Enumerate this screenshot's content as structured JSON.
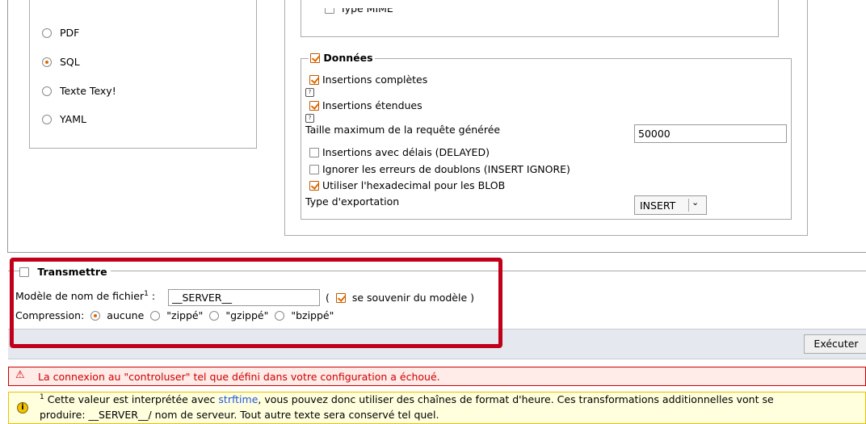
{
  "formats": [
    {
      "label": "PDF",
      "selected": false
    },
    {
      "label": "SQL",
      "selected": true
    },
    {
      "label": "Texte Texy!",
      "selected": false
    },
    {
      "label": "YAML",
      "selected": false
    }
  ],
  "structure": {
    "mime_label": "Type MIME"
  },
  "data_section": {
    "legend": "Données",
    "complete_inserts": "Insertions complètes",
    "extended_inserts": "Insertions étendues",
    "max_query_label": "Taille maximum de la requête générée",
    "max_query_value": "50000",
    "delayed_inserts": "Insertions avec délais (DELAYED)",
    "ignore_errors": "Ignorer les erreurs de doublons (INSERT IGNORE)",
    "hex_blob": "Utiliser l'hexadecimal pour les BLOB",
    "export_type_label": "Type d'exportation",
    "export_type_value": "INSERT"
  },
  "transmit": {
    "legend": "Transmettre",
    "filename_label": "Modèle de nom de fichier",
    "filename_sup": "1",
    "filename_colon": ":",
    "filename_value": "__SERVER__",
    "remember_open": "(",
    "remember_label": "se souvenir du modèle )",
    "compression_label": "Compression:",
    "compression_options": [
      "aucune",
      "\"zippé\"",
      "\"gzippé\"",
      "\"bzippé\""
    ]
  },
  "execute_label": "Exécuter",
  "error_message": "La connexion au \"controluser\" tel que défini dans votre configuration a échoué.",
  "notice": {
    "sup": "1",
    "part1": "Cette valeur est interprétée avec ",
    "link": "strftime",
    "part2": ", vous pouvez donc utiliser des chaînes de format d'heure. Ces transformations additionnelles vont se",
    "line2": "produire: __SERVER__/ nom de serveur. Tout autre texte sera conservé tel quel."
  },
  "colors": {
    "highlight_border": "#c0001a",
    "error_text": "#cc0000",
    "notice_bg": "#ffffdd",
    "check_accent": "#e06a00"
  }
}
